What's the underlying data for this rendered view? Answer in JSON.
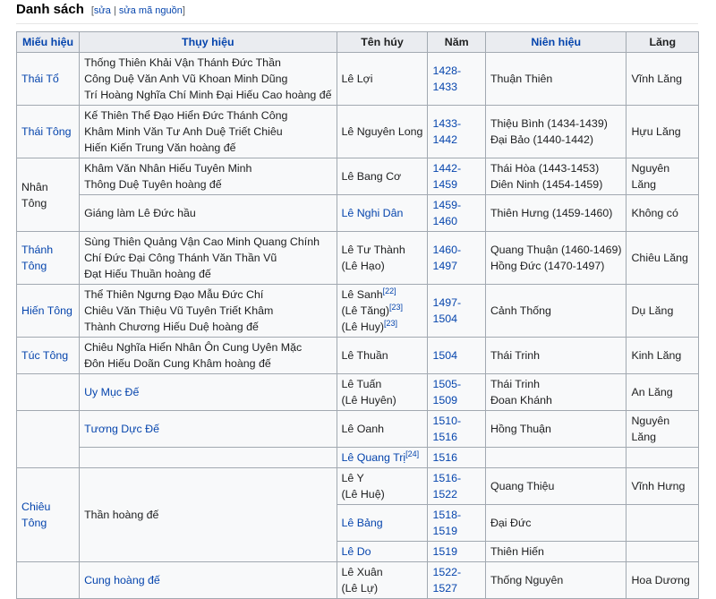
{
  "section": {
    "title": "Danh sách",
    "edit_open": "[",
    "edit_label": "sửa",
    "edit_sep": " | ",
    "edit_source_label": "sửa mã nguồn",
    "edit_close": "]"
  },
  "columns": [
    "Miếu hiệu",
    "Thụy hiệu",
    "Tên húy",
    "Năm",
    "Niên hiệu",
    "Lăng"
  ],
  "rows": [
    {
      "mieu": "Thái Tổ",
      "thuy": [
        "Thống Thiên Khải Vận Thánh Đức Thần",
        "Công Duệ Văn Anh Vũ Khoan Minh Dũng",
        "Trí Hoàng Nghĩa Chí Minh Đại Hiếu Cao hoàng đế"
      ],
      "ten": [
        "Lê Lợi"
      ],
      "nam": "1428-1433",
      "nien": [
        "Thuận Thiên"
      ],
      "lang": "Vĩnh Lăng"
    },
    {
      "mieu": "Thái Tông",
      "thuy": [
        "Kế Thiên Thể Đạo Hiển Đức Thánh Công",
        "Khâm Minh Văn Tư Anh Duệ Triết Chiêu",
        "Hiến Kiến Trung Văn hoàng đế"
      ],
      "ten": [
        "Lê Nguyên Long"
      ],
      "nam": "1433-1442",
      "nien": [
        "Thiệu Bình (1434-1439)",
        "Đại Bảo (1440-1442)"
      ],
      "lang": "Hựu Lăng"
    },
    {
      "mieu": "Nhân Tông",
      "thuy": [
        "Khâm Văn Nhân Hiếu Tuyên Minh",
        "Thông Duệ Tuyên hoàng đế"
      ],
      "ten": [
        "Lê Bang Cơ"
      ],
      "nam": "1442-1459",
      "nien": [
        "Thái Hòa (1443-1453)",
        "Diên Ninh (1454-1459)"
      ],
      "lang": "Nguyên Lăng"
    },
    {
      "thuy": [
        "Giáng làm Lê Đức hầu"
      ],
      "ten": [
        "Lê Nghi Dân"
      ],
      "nam": "1459-1460",
      "nien": [
        "Thiên Hưng (1459-1460)"
      ],
      "lang": "Không có"
    },
    {
      "mieu": "Thánh Tông",
      "thuy": [
        "Sùng Thiên Quảng Vận Cao Minh Quang Chính",
        "Chí Đức Đại Công Thánh Văn Thần Vũ",
        "Đạt Hiếu Thuần hoàng đế"
      ],
      "ten": [
        "Lê Tư Thành",
        "(Lê Hạo)"
      ],
      "nam": "1460-1497",
      "nien": [
        "Quang Thuận (1460-1469)",
        "Hồng Đức (1470-1497)"
      ],
      "lang": "Chiêu Lăng"
    },
    {
      "mieu": "Hiến Tông",
      "thuy": [
        "Thể Thiên Ngưng Đạo Mẫu Đức Chí",
        "Chiêu Văn Thiệu Vũ Tuyên Triết Khâm",
        "Thành Chương Hiếu Duệ hoàng đế"
      ],
      "ten": [
        "Lê Sanh",
        "(Lê Tăng)",
        "(Lê Huy)"
      ],
      "ten_refs": [
        "[22]",
        "[23]",
        "[23]"
      ],
      "nam": "1497-1504",
      "nien": [
        "Cảnh Thống"
      ],
      "lang": "Dụ Lăng"
    },
    {
      "mieu": "Túc Tông",
      "thuy": [
        "Chiêu Nghĩa Hiển Nhân Ôn Cung Uyên Mặc",
        "Đôn Hiếu Doãn Cung Khâm hoàng đế"
      ],
      "ten": [
        "Lê Thuần"
      ],
      "nam": "1504",
      "nien": [
        "Thái Trinh"
      ],
      "lang": "Kinh Lăng"
    },
    {
      "thuy": [
        "Uy Mục Đế"
      ],
      "ten": [
        "Lê Tuấn",
        "(Lê Huyên)"
      ],
      "nam": "1505-1509",
      "nien": [
        "Thái Trinh",
        "Đoan Khánh"
      ],
      "lang": "An Lăng"
    },
    {
      "thuy": [
        "Tương Dực Đế"
      ],
      "ten": [
        "Lê Oanh"
      ],
      "nam": "1510-1516",
      "nien": [
        "Hồng Thuận"
      ],
      "lang": "Nguyên Lăng"
    },
    {
      "ten": [
        "Lê Quang Trị"
      ],
      "ten_refs": [
        "[24]"
      ],
      "nam": "1516"
    },
    {
      "mieu": "Chiêu Tông",
      "thuy": [
        "Thần hoàng đế"
      ],
      "ten": [
        "Lê Y",
        "(Lê Huệ)"
      ],
      "nam": "1516-1522",
      "nien": [
        "Quang Thiệu"
      ],
      "lang": "Vĩnh Hưng"
    },
    {
      "ten": [
        "Lê Bảng"
      ],
      "nam": "1518-1519",
      "nien": [
        "Đại Đức"
      ]
    },
    {
      "ten": [
        "Lê Do"
      ],
      "nam": "1519",
      "nien": [
        "Thiên Hiến"
      ]
    },
    {
      "thuy": [
        "Cung hoàng đế"
      ],
      "ten": [
        "Lê Xuân",
        "(Lê Lự)"
      ],
      "nam": "1522-1527",
      "nien": [
        "Thống Nguyên"
      ],
      "lang": "Hoa Dương"
    }
  ]
}
